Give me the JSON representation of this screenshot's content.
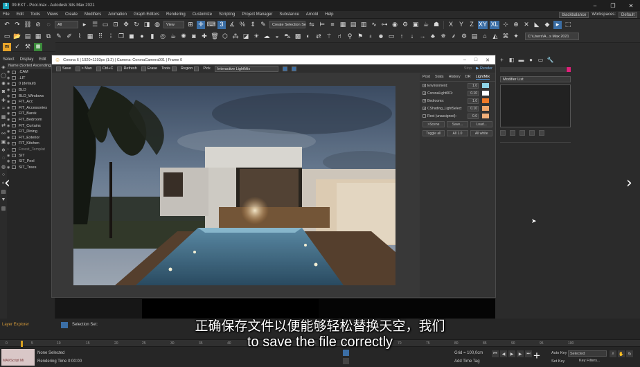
{
  "window": {
    "title": "09.EXT - Pool.max - Autodesk 3ds Max 2021",
    "controls": [
      "–",
      "❐",
      "✕"
    ]
  },
  "menubar": {
    "items": [
      "File",
      "Edit",
      "Tools",
      "Views",
      "Create",
      "Modifiers",
      "Animation",
      "Graph Editors",
      "Rendering",
      "Customize",
      "Scripting",
      "Project Manager",
      "Substance",
      "Arnold",
      "Help"
    ],
    "user": "blackbalance",
    "workspaces_label": "Workspaces:",
    "workspace_value": "Default"
  },
  "toolbar": {
    "all_dropdown": "All",
    "view_dropdown": "View",
    "selection_set": "Create Selection Se",
    "xyz": [
      "X",
      "Y",
      "Z",
      "XY",
      "XL"
    ],
    "path": "C:\\Users\\A...s Max 2021"
  },
  "scene_explorer": {
    "tabs": [
      "Select",
      "Display",
      "Edit"
    ],
    "header": "Name (Sorted Ascending)",
    "rows": [
      {
        "label": ".CAM",
        "dim": false
      },
      {
        "label": ".LIT",
        "dim": false
      },
      {
        "label": "0 (default)",
        "dim": false
      },
      {
        "label": "BLD",
        "dim": false
      },
      {
        "label": "BLD_Windows",
        "dim": false
      },
      {
        "label": "FIT_Acc",
        "dim": false
      },
      {
        "label": "FIT_Accessories",
        "dim": false
      },
      {
        "label": "FIT_Barek",
        "dim": false
      },
      {
        "label": "FIT_Bedroom",
        "dim": false
      },
      {
        "label": "FIT_Curtains",
        "dim": false
      },
      {
        "label": "FIT_Dining",
        "dim": false
      },
      {
        "label": "FIT_Exterior",
        "dim": false
      },
      {
        "label": "FIT_Kitchen",
        "dim": false
      },
      {
        "label": "Forest_Templat",
        "dim": true
      },
      {
        "label": "SIT",
        "dim": false
      },
      {
        "label": "SIT_Pool",
        "dim": false
      },
      {
        "label": "SIT_Trees",
        "dim": false
      }
    ]
  },
  "vfb": {
    "title": "Corona 6 | 1920×1193px (1:2) | Camera: CoronaCamera001 | Frame 0",
    "buttons": [
      "Save",
      "> Max",
      "Ctrl+C",
      "Refresh",
      "Erase",
      "Tools",
      "Region",
      "Pick"
    ],
    "mode": "Interactive LightMix",
    "stop_label": "Stop",
    "render_label": "Render",
    "tabs": [
      "Post",
      "Stats",
      "History",
      "DR",
      "LightMix"
    ],
    "active_tab": "LightMix",
    "lightmix": [
      {
        "name": "Environment:",
        "value": "1.0",
        "checked": true,
        "color": "#8fd4e8"
      },
      {
        "name": "CoronaLight001:",
        "value": "0.10",
        "checked": true,
        "color": "#ffffff"
      },
      {
        "name": "Bedrooms:",
        "value": "1.0",
        "checked": true,
        "color": "#f07a28"
      },
      {
        "name": "CShading_LightSelect",
        "value": "0.10",
        "checked": true,
        "color": "#f2a86c"
      },
      {
        "name": "Rest (unassigned):",
        "value": "0.0",
        "checked": false,
        "color": "#f2b07a"
      }
    ],
    "lm_buttons_1": [
      ">Scene",
      "Save...",
      "Load..."
    ],
    "lm_buttons_2": [
      "Toggle all",
      "All 1.0",
      "All white"
    ]
  },
  "command_panel": {
    "modifier_list": "Modifier List",
    "name_color": "#e0207a"
  },
  "layer_explorer": {
    "label": "Layer Explorer",
    "selection_set_label": "Selection Set:"
  },
  "timeline": {
    "ticks": [
      "0",
      "5",
      "10",
      "15",
      "20",
      "25",
      "30",
      "35",
      "40",
      "45",
      "50",
      "55",
      "60",
      "65",
      "70",
      "75",
      "80",
      "85",
      "90",
      "95",
      "100"
    ]
  },
  "status": {
    "maxscript": "MAXScript Mi",
    "none_selected": "None Selected",
    "rendering_time": "Rendering Time  0:00:00",
    "grid": "Grid = 100,0cm",
    "add_time_tag": "Add Time Tag",
    "auto_key": "Auto Key",
    "selected": "Selected",
    "set_key": "Set Key",
    "key_filters": "Key Filters..."
  },
  "subtitles": {
    "zh": "正确保存文件以便能够轻松替换天空，我们",
    "en": "to save the file correctly"
  },
  "nav": {
    "prev": "‹",
    "next": "›"
  }
}
